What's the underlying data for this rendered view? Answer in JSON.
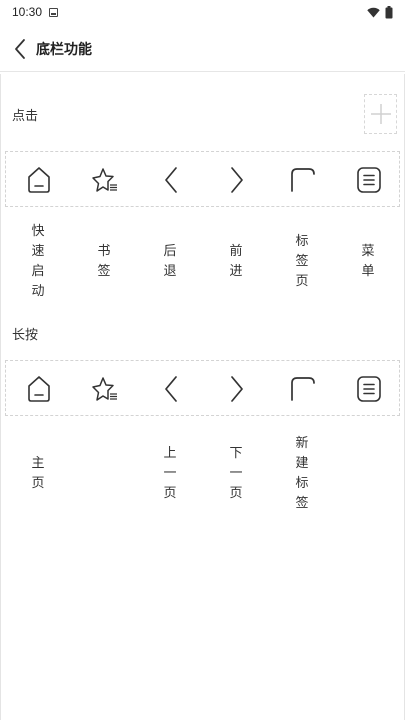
{
  "status_bar": {
    "time": "10:30"
  },
  "header": {
    "title": "底栏功能"
  },
  "sections": {
    "click": {
      "label": "点击",
      "icons": [
        "home-icon",
        "bookmark-star-icon",
        "chevron-left-icon",
        "chevron-right-icon",
        "tabs-icon",
        "menu-icon"
      ],
      "labels": [
        "快速启动",
        "书签",
        "后退",
        "前进",
        "标签页",
        "菜单"
      ]
    },
    "long_press": {
      "label": "长按",
      "icons": [
        "home-icon",
        "bookmark-star-icon",
        "chevron-left-icon",
        "chevron-right-icon",
        "tabs-icon",
        "menu-icon"
      ],
      "labels": [
        "主页",
        "",
        "上一页",
        "下一页",
        "新建标签",
        ""
      ]
    }
  },
  "colors": {
    "icon": "#333333",
    "dashed_border": "#d3d3d3",
    "divider": "#e6e6e6"
  }
}
